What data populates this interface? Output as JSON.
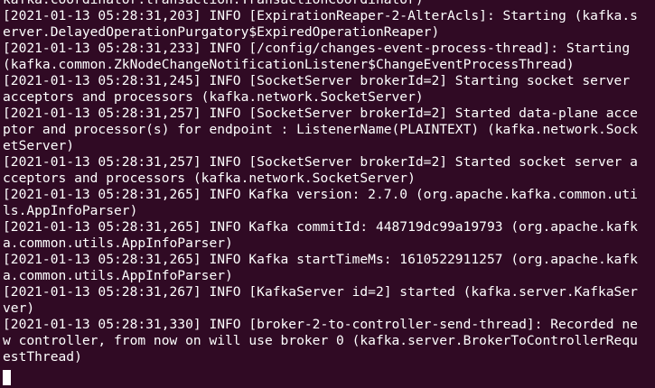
{
  "terminal": {
    "lines": [
      "kafka.coordinator.transaction.TransactionCoordinator)",
      "[2021-01-13 05:28:31,203] INFO [ExpirationReaper-2-AlterAcls]: Starting (kafka.s",
      "erver.DelayedOperationPurgatory$ExpiredOperationReaper)",
      "[2021-01-13 05:28:31,233] INFO [/config/changes-event-process-thread]: Starting",
      "(kafka.common.ZkNodeChangeNotificationListener$ChangeEventProcessThread)",
      "[2021-01-13 05:28:31,245] INFO [SocketServer brokerId=2] Starting socket server",
      "acceptors and processors (kafka.network.SocketServer)",
      "[2021-01-13 05:28:31,257] INFO [SocketServer brokerId=2] Started data-plane acce",
      "ptor and processor(s) for endpoint : ListenerName(PLAINTEXT) (kafka.network.Sock",
      "etServer)",
      "[2021-01-13 05:28:31,257] INFO [SocketServer brokerId=2] Started socket server a",
      "cceptors and processors (kafka.network.SocketServer)",
      "[2021-01-13 05:28:31,265] INFO Kafka version: 2.7.0 (org.apache.kafka.common.uti",
      "ls.AppInfoParser)",
      "[2021-01-13 05:28:31,265] INFO Kafka commitId: 448719dc99a19793 (org.apache.kafk",
      "a.common.utils.AppInfoParser)",
      "[2021-01-13 05:28:31,265] INFO Kafka startTimeMs: 1610522911257 (org.apache.kafk",
      "a.common.utils.AppInfoParser)",
      "[2021-01-13 05:28:31,267] INFO [KafkaServer id=2] started (kafka.server.KafkaSer",
      "ver)",
      "[2021-01-13 05:28:31,330] INFO [broker-2-to-controller-send-thread]: Recorded ne",
      "w controller, from now on will use broker 0 (kafka.server.BrokerToControllerRequ",
      "estThread)"
    ],
    "colors": {
      "background": "#300a24",
      "foreground": "#ffffff"
    }
  }
}
